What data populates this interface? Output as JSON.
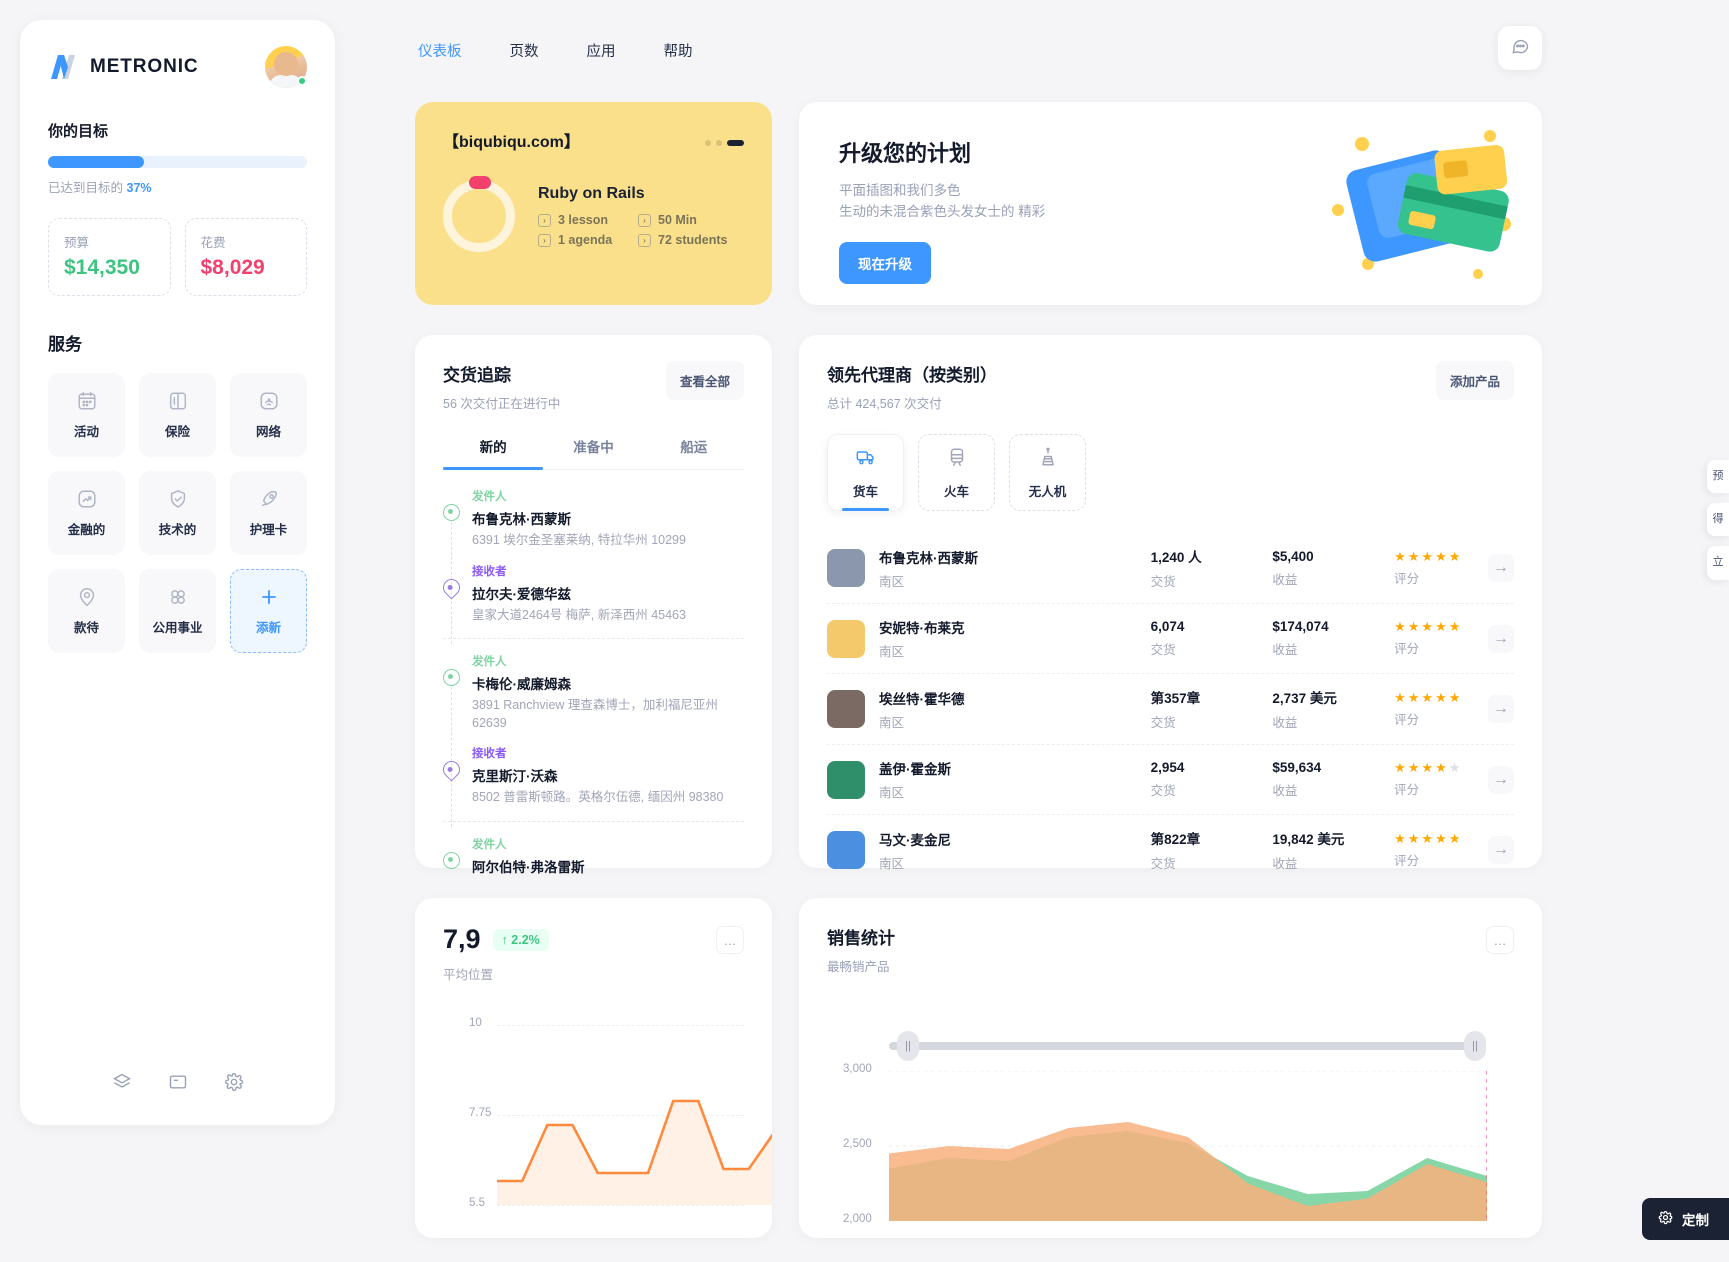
{
  "brand": {
    "name": "METRONIC"
  },
  "topnav": {
    "items": [
      {
        "label": "仪表板",
        "active": true
      },
      {
        "label": "页数",
        "active": false
      },
      {
        "label": "应用",
        "active": false
      },
      {
        "label": "帮助",
        "active": false
      }
    ]
  },
  "sidebar": {
    "goal": {
      "title": "你的目标",
      "progress_percent": 37,
      "caption_prefix": "已达到目标的",
      "caption_value": "37%"
    },
    "stats": [
      {
        "label": "预算",
        "value": "$14,350",
        "color": "#3ec480"
      },
      {
        "label": "花费",
        "value": "$8,029",
        "color": "#f1416c"
      }
    ],
    "services_title": "服务",
    "services": [
      {
        "label": "活动",
        "icon": "calendar-icon"
      },
      {
        "label": "保险",
        "icon": "book-icon"
      },
      {
        "label": "网络",
        "icon": "wifi-icon"
      },
      {
        "label": "金融的",
        "icon": "chart-up-icon"
      },
      {
        "label": "技术的",
        "icon": "shield-check-icon"
      },
      {
        "label": "护理卡",
        "icon": "rocket-icon"
      },
      {
        "label": "款待",
        "icon": "location-pin-icon"
      },
      {
        "label": "公用事业",
        "icon": "four-dots-icon"
      },
      {
        "label": "添新",
        "icon": "plus-icon",
        "add": true
      }
    ],
    "footer_icons": [
      "layers-icon",
      "notes-icon",
      "gear-icon"
    ]
  },
  "promo": {
    "title": "【biqubiqu.com】",
    "course": "Ruby on Rails",
    "meta": [
      "3 lesson",
      "50 Min",
      "1 agenda",
      "72 students"
    ]
  },
  "upgrade": {
    "title": "升级您的计划",
    "line1": "平面插图和我们多色",
    "line2": "生动的未混合紫色头发女士的 精彩",
    "button": "现在升级"
  },
  "delivery": {
    "title": "交货追踪",
    "subtitle": "56 次交付正在进行中",
    "view_all": "查看全部",
    "tabs": [
      {
        "label": "新的",
        "active": true
      },
      {
        "label": "准备中",
        "active": false
      },
      {
        "label": "船运",
        "active": false
      }
    ],
    "label_sender": "发件人",
    "label_receiver": "接收者",
    "entries": [
      {
        "kind": "send",
        "name": "布鲁克林·西蒙斯",
        "address": "6391 埃尔金圣塞莱纳, 特拉华州 10299"
      },
      {
        "kind": "recv",
        "name": "拉尔夫·爱德华兹",
        "address": "皇家大道2464号 梅萨, 新泽西州 45463"
      },
      {
        "kind": "send",
        "name": "卡梅伦·威廉姆森",
        "address": "3891 Ranchview 理查森博士，加利福尼亚州 62639"
      },
      {
        "kind": "recv",
        "name": "克里斯汀·沃森",
        "address": "8502 普雷斯顿路。英格尔伍德, 缅因州 98380"
      },
      {
        "kind": "send",
        "name": "阿尔伯特·弗洛雷斯",
        "address": ""
      }
    ]
  },
  "agents": {
    "title": "领先代理商（按类别）",
    "subtitle": "总计 424,567 次交付",
    "add_button": "添加产品",
    "modes": [
      {
        "label": "货车",
        "icon": "truck-icon",
        "active": true
      },
      {
        "label": "火车",
        "icon": "train-icon",
        "active": false
      },
      {
        "label": "无人机",
        "icon": "drone-icon",
        "active": false
      }
    ],
    "caption_delivery": "交货",
    "caption_revenue": "收益",
    "caption_rating": "评分",
    "rows": [
      {
        "name": "布鲁克林·西蒙斯",
        "region": "南区",
        "delivery": "1,240 人",
        "revenue": "$5,400",
        "stars": 5,
        "avatar": "#8a97ad"
      },
      {
        "name": "安妮特·布莱克",
        "region": "南区",
        "delivery": "6,074",
        "revenue": "$174,074",
        "stars": 5,
        "avatar": "#f3c96b"
      },
      {
        "name": "埃丝特·霍华德",
        "region": "南区",
        "delivery": "第357章",
        "revenue": "2,737 美元",
        "stars": 5,
        "avatar": "#7b6a63"
      },
      {
        "name": "盖伊·霍金斯",
        "region": "南区",
        "delivery": "2,954",
        "revenue": "$59,634",
        "stars": 4,
        "avatar": "#2f8f6a"
      },
      {
        "name": "马文·麦金尼",
        "region": "南区",
        "delivery": "第822章",
        "revenue": "19,842 美元",
        "stars": 5,
        "avatar": "#4b8fe0"
      }
    ]
  },
  "avgpos": {
    "value": "7,9",
    "delta": "↑ 2.2%",
    "caption": "平均位置",
    "menu": "…"
  },
  "sales": {
    "title": "销售统计",
    "subtitle": "最畅销产品",
    "menu": "…"
  },
  "rail": {
    "tabs": [
      "预",
      "得",
      "立"
    ]
  },
  "customize": {
    "label": "定制",
    "icon": "gear-icon"
  },
  "chart_data": [
    {
      "type": "line",
      "title": "平均位置",
      "yticks": [
        10,
        7.75,
        5.5
      ],
      "ylim": [
        5.5,
        10
      ],
      "x": [
        0,
        1,
        2,
        3,
        4,
        5,
        6,
        7,
        8,
        9,
        10,
        11,
        12
      ],
      "values": [
        6.1,
        6.1,
        7.5,
        7.5,
        6.3,
        6.3,
        6.3,
        8.1,
        8.1,
        6.4,
        6.4,
        7.3,
        7.3
      ],
      "grid": true,
      "color": "#ff8a3d"
    },
    {
      "type": "area",
      "title": "销售统计",
      "subtitle": "最畅销产品",
      "yticks": [
        3000,
        2500,
        2000
      ],
      "ylim": [
        2000,
        3000
      ],
      "x": [
        0,
        1,
        2,
        3,
        4,
        5,
        6,
        7,
        8,
        9,
        10
      ],
      "series": [
        {
          "name": "series-green",
          "values": [
            2350,
            2420,
            2400,
            2560,
            2600,
            2520,
            2300,
            2180,
            2200,
            2420,
            2300
          ],
          "color": "#7fd4a2"
        },
        {
          "name": "series-orange",
          "values": [
            2450,
            2500,
            2480,
            2620,
            2660,
            2560,
            2250,
            2100,
            2150,
            2380,
            2260
          ],
          "color": "#f8b07c"
        }
      ],
      "grid": true,
      "marker_x": 10,
      "marker_color": "#f1416c"
    }
  ]
}
